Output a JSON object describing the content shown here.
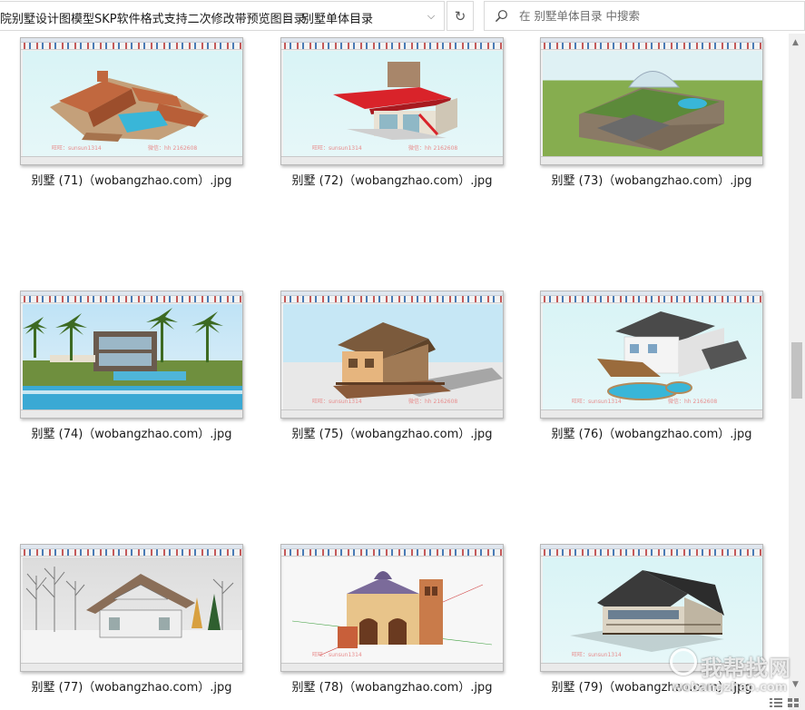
{
  "address_bar": {
    "crumb_parent": "院别墅设计图模型SKP软件格式支持二次修改带预览图目录",
    "separator": "›",
    "crumb_current": "别墅单体目录",
    "dropdown_glyph": "⌵",
    "refresh_glyph": "↻"
  },
  "search": {
    "placeholder": "在 别墅单体目录 中搜索",
    "icon": "search-icon"
  },
  "files": [
    {
      "label": "别墅 (71)（wobangzhao.com）.jpg",
      "scene": "tuscan-villa-pool",
      "sky": "#d9f4f6",
      "watermark_left": "旺旺：sunsun1314",
      "watermark_right": "微信：hh 2162608"
    },
    {
      "label": "别墅 (72)（wobangzhao.com）.jpg",
      "scene": "modern-red-roof",
      "sky": "#d9f4f6",
      "watermark_left": "旺旺：sunsun1314",
      "watermark_right": "微信：hh 2162608"
    },
    {
      "label": "别墅 (73)（wobangzhao.com）.jpg",
      "scene": "stone-house-dome",
      "sky": "#d9f4f6",
      "watermark_left": "",
      "watermark_right": ""
    },
    {
      "label": "别墅 (74)（wobangzhao.com）.jpg",
      "scene": "palm-modern-house",
      "sky": "#bfe3f6",
      "watermark_left": "",
      "watermark_right": ""
    },
    {
      "label": "别墅 (75)（wobangzhao.com）.jpg",
      "scene": "cottage",
      "sky": "#bfe3f6",
      "watermark_left": "旺旺：sunsun1314",
      "watermark_right": "微信：hh 2162608"
    },
    {
      "label": "别墅 (76)（wobangzhao.com）.jpg",
      "scene": "white-house-pool",
      "sky": "#d9f4f6",
      "watermark_left": "旺旺：sunsun1314",
      "watermark_right": "微信：hh 2162608"
    },
    {
      "label": "别墅 (77)（wobangzhao.com）.jpg",
      "scene": "snow-chalet",
      "sky": "#dcdcdc",
      "watermark_left": "",
      "watermark_right": ""
    },
    {
      "label": "别墅 (78)（wobangzhao.com）.jpg",
      "scene": "church-tower",
      "sky": "#f7f7f7",
      "watermark_left": "旺旺：sunsun1314",
      "watermark_right": ""
    },
    {
      "label": "别墅 (79)（wobangzhao.com）.jpg",
      "scene": "black-roof-house",
      "sky": "#d9f4f6",
      "watermark_left": "旺旺：sunsun1314",
      "watermark_right": ""
    }
  ],
  "watermark_logo": {
    "name": "我帮找网",
    "url": "wobangzhao.com"
  },
  "colors": {
    "terracotta": "#c1683f",
    "red_roof": "#d9232a",
    "grass": "#7fa64a",
    "water": "#39b6d8",
    "wall_beige": "#e8c48a"
  }
}
